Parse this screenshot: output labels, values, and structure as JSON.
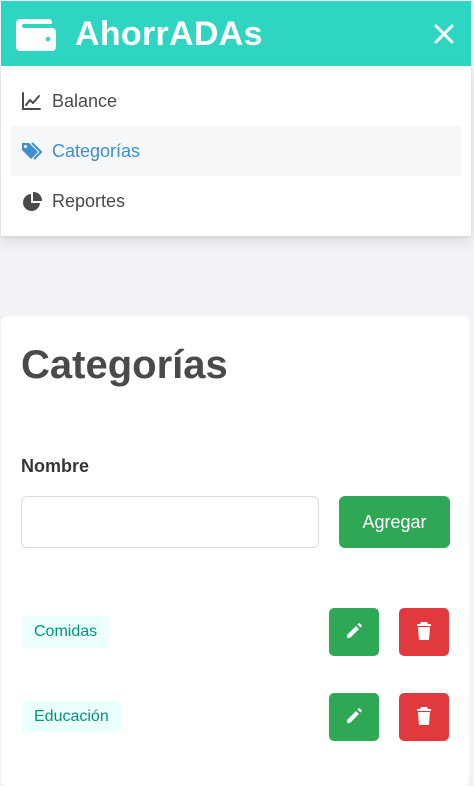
{
  "navbar": {
    "title": "AhorrADAs",
    "brand_icon": "wallet-icon",
    "close_icon": "close-icon",
    "background": "#2ed6c2"
  },
  "menu": {
    "items": [
      {
        "label": "Balance",
        "icon": "chart-line-icon",
        "active": false
      },
      {
        "label": "Categorías",
        "icon": "tags-icon",
        "active": true
      },
      {
        "label": "Reportes",
        "icon": "pie-chart-icon",
        "active": false
      }
    ],
    "active_color": "#3e8ed0"
  },
  "main": {
    "title": "Categorías",
    "form": {
      "label": "Nombre",
      "value": "",
      "placeholder": "",
      "submit_label": "Agregar"
    },
    "categories": [
      {
        "name": "Comidas",
        "edit_icon": "pencil-icon",
        "delete_icon": "trash-icon"
      },
      {
        "name": "Educación",
        "edit_icon": "pencil-icon",
        "delete_icon": "trash-icon"
      }
    ]
  },
  "colors": {
    "success": "#2ea855",
    "danger": "#e03a3e",
    "tag_bg": "#ebfffc",
    "tag_text": "#00947e"
  }
}
